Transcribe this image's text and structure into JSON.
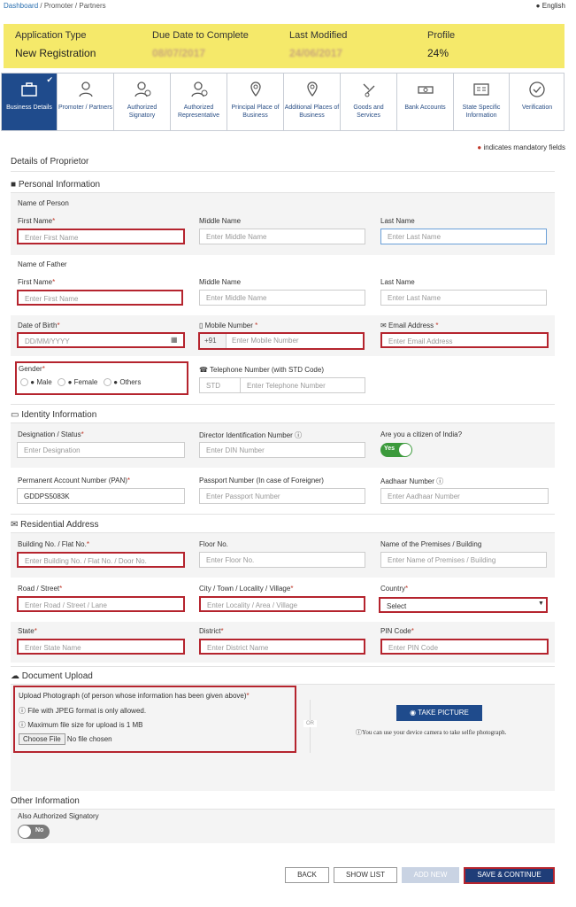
{
  "breadcrumb": {
    "home": "Dashboard",
    "sep": " / ",
    "current": "Promoter / Partners"
  },
  "language": "English",
  "app": {
    "type_label": "Application Type",
    "type_value": "New Registration",
    "due_label": "Due Date to Complete",
    "due_value": "08/07/2017",
    "modified_label": "Last Modified",
    "modified_value": "24/06/2017",
    "profile_label": "Profile",
    "profile_value": "24%"
  },
  "steps": [
    {
      "label": "Business Details"
    },
    {
      "label": "Promoter / Partners"
    },
    {
      "label": "Authorized Signatory"
    },
    {
      "label": "Authorized Representative"
    },
    {
      "label": "Principal Place of Business"
    },
    {
      "label": "Additional Places of Business"
    },
    {
      "label": "Goods and Services"
    },
    {
      "label": "Bank Accounts"
    },
    {
      "label": "State Specific Information"
    },
    {
      "label": "Verification"
    }
  ],
  "mandatory_note": "indicates mandatory fields",
  "form_title": "Details of Proprietor",
  "personal": {
    "title": "Personal Information",
    "name_of_person": "Name of Person",
    "first_name": "First Name",
    "first_name_ph": "Enter First Name",
    "middle_name": "Middle Name",
    "middle_name_ph": "Enter Middle Name",
    "last_name": "Last Name",
    "last_name_ph": "Enter Last Name",
    "name_of_father": "Name of Father",
    "dob": "Date of Birth",
    "dob_ph": "DD/MM/YYYY",
    "mobile": "Mobile Number",
    "mobile_code": "+91",
    "mobile_ph": "Enter Mobile Number",
    "email": "Email Address",
    "email_ph": "Enter Email Address",
    "gender": "Gender",
    "male": "Male",
    "female": "Female",
    "others": "Others",
    "telephone": "Telephone Number (with STD Code)",
    "std_ph": "STD",
    "tel_ph": "Enter Telephone Number"
  },
  "identity": {
    "title": "Identity Information",
    "designation": "Designation / Status",
    "designation_ph": "Enter Designation",
    "din": "Director Identification Number",
    "din_ph": "Enter DIN Number",
    "citizen": "Are you a citizen of India?",
    "citizen_toggle": "Yes",
    "pan": "Permanent Account Number (PAN)",
    "pan_value": "GDDPS5083K",
    "passport": "Passport Number (In case of Foreigner)",
    "passport_ph": "Enter Passport Number",
    "aadhaar": "Aadhaar Number",
    "aadhaar_ph": "Enter Aadhaar Number"
  },
  "address": {
    "title": "Residential Address",
    "building": "Building No. / Flat No.",
    "building_ph": "Enter Building No. / Flat No. / Door No.",
    "floor": "Floor No.",
    "floor_ph": "Enter Floor No.",
    "premises": "Name of the Premises / Building",
    "premises_ph": "Enter Name of Premises / Building",
    "road": "Road / Street",
    "road_ph": "Enter Road / Street / Lane",
    "city": "City / Town / Locality / Village",
    "city_ph": "Enter Locality / Area / Village",
    "country": "Country",
    "country_value": "Select",
    "state": "State",
    "state_ph": "Enter State Name",
    "district": "District",
    "district_ph": "Enter District Name",
    "pin": "PIN Code",
    "pin_ph": "Enter PIN Code"
  },
  "upload": {
    "title": "Document Upload",
    "label": "Upload Photograph (of person whose information has been given above)",
    "note1": "File with JPEG format is only allowed.",
    "note2": "Maximum file size for upload is 1 MB",
    "choose": "Choose File",
    "no_file": "No file chosen",
    "or": "OR",
    "take_picture": "TAKE PICTURE",
    "camera_note": "You can use your device camera to take selfie photograph."
  },
  "other": {
    "title": "Other Information",
    "signatory": "Also Authorized Signatory",
    "toggle": "No"
  },
  "buttons": {
    "back": "BACK",
    "show_list": "SHOW LIST",
    "add_new": "ADD NEW",
    "save": "SAVE & CONTINUE"
  },
  "colors": {
    "accent": "#1f4b8c",
    "error": "#b5242e",
    "banner": "#f5e96a"
  }
}
